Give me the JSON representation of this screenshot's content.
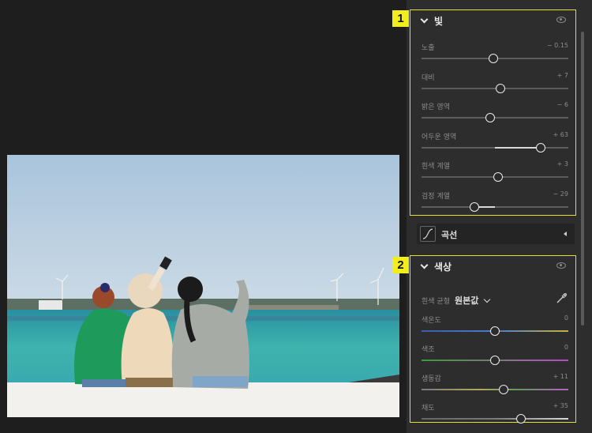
{
  "light_section": {
    "badge": "1",
    "title": "빛",
    "sliders": [
      {
        "label": "노출",
        "value": "− 0.15",
        "level": 0.49,
        "fill": "none"
      },
      {
        "label": "대비",
        "value": "+ 7",
        "level": 0.54,
        "fill": "none"
      },
      {
        "label": "밝은 영역",
        "value": "− 6",
        "level": 0.47,
        "fill": "none"
      },
      {
        "label": "어두운 영역",
        "value": "+ 63",
        "level": 0.81,
        "fill": "right"
      },
      {
        "label": "흰색 계열",
        "value": "+ 3",
        "level": 0.52,
        "fill": "none"
      },
      {
        "label": "검정 계열",
        "value": "− 29",
        "level": 0.36,
        "fill": "left"
      }
    ]
  },
  "curve_row": {
    "label": "곡선"
  },
  "color_section": {
    "badge": "2",
    "title": "색상",
    "white_balance": {
      "label": "흰색 균형",
      "value": "원본값"
    },
    "sliders": [
      {
        "label": "색온도",
        "value": "0",
        "level": 0.5,
        "gradient": "linear-gradient(90deg,#3a5ea8,#4b7bd0 50%,#c9b13a)"
      },
      {
        "label": "색조",
        "value": "0",
        "level": 0.5,
        "gradient": "linear-gradient(90deg,#3b9a3b,#7a7a7a 50%,#b34cc7)"
      },
      {
        "label": "생동감",
        "value": "+ 11",
        "level": 0.56,
        "gradient": "linear-gradient(90deg,#7a7a7a,#b2a95a 40%,#5f9a5f 65%,#b85dc4)"
      },
      {
        "label": "채도",
        "value": "+ 35",
        "level": 0.68,
        "gradient": "linear-gradient(90deg,#666,#7a7a7a 50%,#d8d8d8)"
      }
    ]
  },
  "colors": {
    "highlight": "#e3df2a",
    "badge": "#f2ee1c",
    "panel": "#2d2d2d",
    "canvas": "#1e1e1e"
  }
}
